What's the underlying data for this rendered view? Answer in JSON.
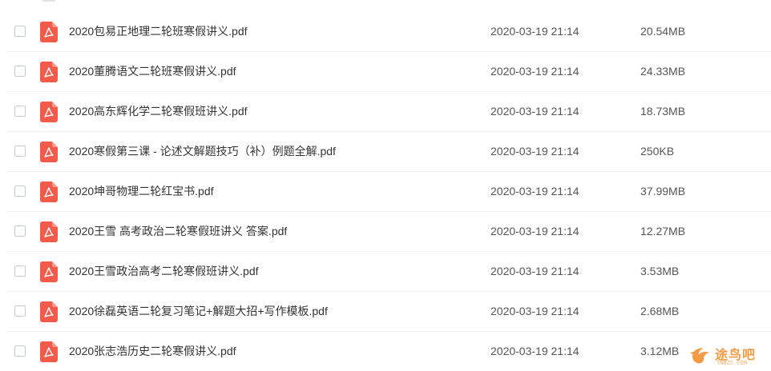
{
  "colors": {
    "pdf_icon": "#f25a4a",
    "text_primary": "#333333",
    "text_secondary": "#555555",
    "watermark": "#f08a24"
  },
  "icons": {
    "file_type": "pdf-icon",
    "select": "checkbox"
  },
  "files": [
    {
      "name": "2020包易正地理二轮班寒假讲义.pdf",
      "modified": "2020-03-19 21:14",
      "size": "20.54MB"
    },
    {
      "name": "2020董腾语文二轮班寒假讲义.pdf",
      "modified": "2020-03-19 21:14",
      "size": "24.33MB"
    },
    {
      "name": "2020高东辉化学二轮寒假班讲义.pdf",
      "modified": "2020-03-19 21:14",
      "size": "18.73MB"
    },
    {
      "name": "2020寒假第三课 - 论述文解题技巧（补）例题全解.pdf",
      "modified": "2020-03-19 21:14",
      "size": "250KB"
    },
    {
      "name": "2020坤哥物理二轮红宝书.pdf",
      "modified": "2020-03-19 21:14",
      "size": "37.99MB"
    },
    {
      "name": "2020王雪 高考政治二轮寒假班讲义 答案.pdf",
      "modified": "2020-03-19 21:14",
      "size": "12.27MB"
    },
    {
      "name": "2020王雪政治高考二轮寒假班讲义.pdf",
      "modified": "2020-03-19 21:14",
      "size": "3.53MB"
    },
    {
      "name": "2020徐磊英语二轮复习笔记+解题大招+写作模板.pdf",
      "modified": "2020-03-19 21:14",
      "size": "2.68MB"
    },
    {
      "name": "2020张志浩历史二轮寒假讲义.pdf",
      "modified": "2020-03-19 21:14",
      "size": "3.12MB"
    }
  ],
  "watermark": {
    "text": "途鸟吧",
    "sub": "TNBZS.COM"
  }
}
